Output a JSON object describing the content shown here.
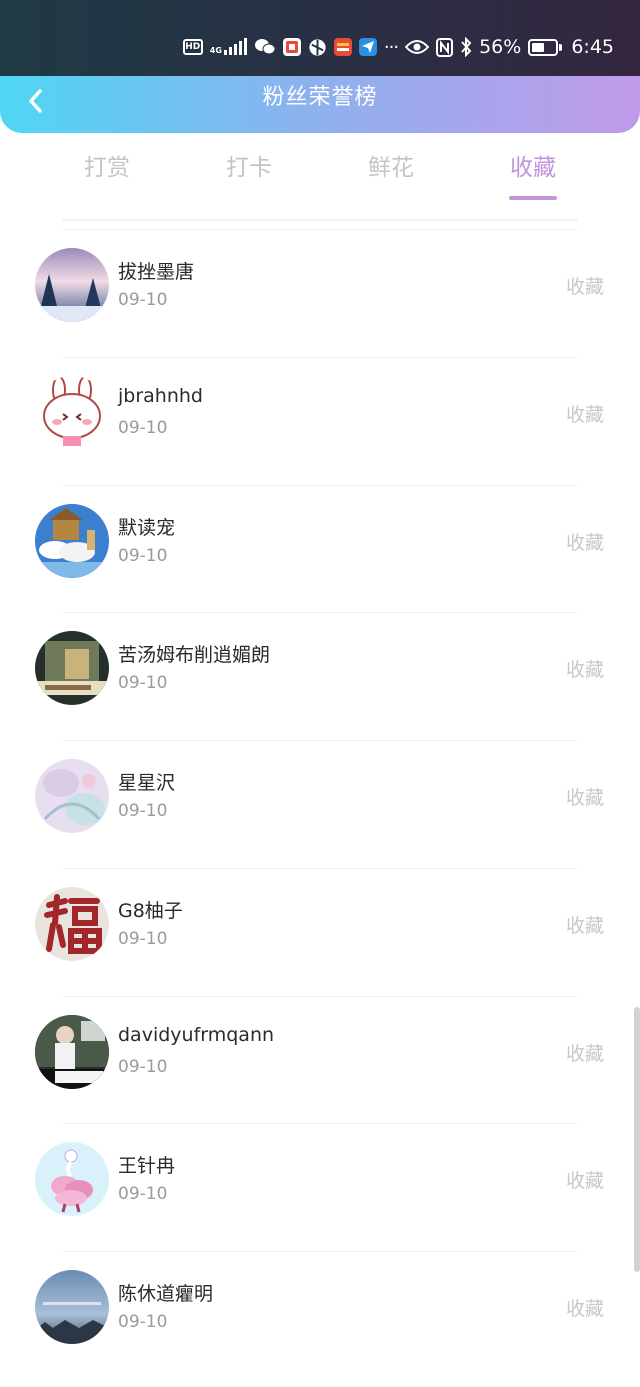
{
  "status_bar": {
    "hd": "HD",
    "network": "4G",
    "battery_percent": "56%",
    "time": "6:45",
    "more": "···",
    "battery_level": 0.56,
    "icons": [
      "hd-icon",
      "signal-icon",
      "wechat-icon",
      "app-icon",
      "browser-icon",
      "news-icon",
      "send-icon",
      "more-icon",
      "eye-icon",
      "nfc-icon",
      "bluetooth-icon",
      "battery-icon"
    ]
  },
  "header": {
    "title": "粉丝荣誉榜",
    "back_icon": "back-arrow-icon"
  },
  "tabs": [
    {
      "label": "打赏",
      "active": false
    },
    {
      "label": "打卡",
      "active": false
    },
    {
      "label": "鲜花",
      "active": false
    },
    {
      "label": "收藏",
      "active": true
    }
  ],
  "colors": {
    "accent": "#c194dc",
    "header_gradient_start": "#4fd6f4",
    "header_gradient_end": "#c19aea",
    "inactive_tab": "#c4c4c4"
  },
  "list": [
    {
      "name": "拔挫墨唐",
      "date": "09-10",
      "action": "收藏",
      "avatar": "snow-forest-avatar"
    },
    {
      "name": "jbrahnhd",
      "date": "09-10",
      "action": "收藏",
      "avatar": "bunny-cartoon-avatar"
    },
    {
      "name": "默读宠",
      "date": "09-10",
      "action": "收藏",
      "avatar": "cloud-house-avatar"
    },
    {
      "name": "苦汤姆布削逍媚朗",
      "date": "09-10",
      "action": "收藏",
      "avatar": "dark-scene-avatar"
    },
    {
      "name": "星星沢",
      "date": "09-10",
      "action": "收藏",
      "avatar": "pastel-floral-avatar"
    },
    {
      "name": "G8柚子",
      "date": "09-10",
      "action": "收藏",
      "avatar": "fu-calligraphy-avatar"
    },
    {
      "name": "davidyufrmqann",
      "date": "09-10",
      "action": "收藏",
      "avatar": "girl-photo-avatar"
    },
    {
      "name": "王针冉",
      "date": "09-10",
      "action": "收藏",
      "avatar": "pink-character-avatar"
    },
    {
      "name": "陈休道癯明",
      "date": "09-10",
      "action": "收藏",
      "avatar": "blue-sky-avatar"
    }
  ]
}
